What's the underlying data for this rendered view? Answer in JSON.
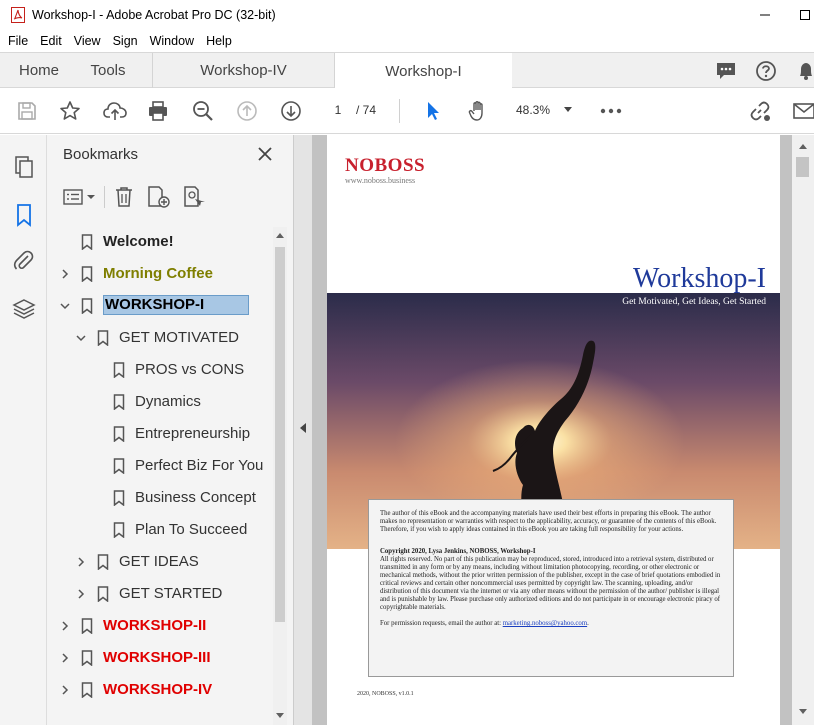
{
  "window": {
    "title": "Workshop-I - Adobe Acrobat Pro DC (32-bit)"
  },
  "menu": [
    "File",
    "Edit",
    "View",
    "Sign",
    "Window",
    "Help"
  ],
  "tabs": {
    "home": "Home",
    "tools": "Tools",
    "doc1": "Workshop-IV",
    "doc2": "Workshop-I"
  },
  "toolbar": {
    "page_current": "1",
    "page_total": "/ 74",
    "zoom": "48.3%"
  },
  "bookmarks": {
    "title": "Bookmarks",
    "items": [
      {
        "label": "Welcome!",
        "color": "#222222",
        "bold": true,
        "level": 0,
        "expander": "none"
      },
      {
        "label": "Morning Coffee",
        "color": "#7f7f00",
        "bold": true,
        "level": 0,
        "expander": "collapsed"
      },
      {
        "label": "WORKSHOP-I",
        "color": "#000000",
        "bold": true,
        "level": 0,
        "expander": "expanded",
        "selected": true
      },
      {
        "label": "GET MOTIVATED",
        "color": "#333333",
        "bold": false,
        "level": 1,
        "expander": "expanded"
      },
      {
        "label": "PROS vs CONS",
        "color": "#333333",
        "bold": false,
        "level": 2,
        "expander": "none"
      },
      {
        "label": "Dynamics",
        "color": "#333333",
        "bold": false,
        "level": 2,
        "expander": "none"
      },
      {
        "label": "Entrepreneurship",
        "color": "#333333",
        "bold": false,
        "level": 2,
        "expander": "none"
      },
      {
        "label": "Perfect Biz For You",
        "color": "#333333",
        "bold": false,
        "level": 2,
        "expander": "none"
      },
      {
        "label": "Business Concept",
        "color": "#333333",
        "bold": false,
        "level": 2,
        "expander": "none"
      },
      {
        "label": "Plan To Succeed",
        "color": "#333333",
        "bold": false,
        "level": 2,
        "expander": "none"
      },
      {
        "label": "GET IDEAS",
        "color": "#333333",
        "bold": false,
        "level": 1,
        "expander": "collapsed"
      },
      {
        "label": "GET STARTED",
        "color": "#333333",
        "bold": false,
        "level": 1,
        "expander": "collapsed"
      },
      {
        "label": "WORKSHOP-II",
        "color": "#e00000",
        "bold": true,
        "level": 0,
        "expander": "collapsed"
      },
      {
        "label": "WORKSHOP-III",
        "color": "#e00000",
        "bold": true,
        "level": 0,
        "expander": "collapsed"
      },
      {
        "label": "WORKSHOP-IV",
        "color": "#e00000",
        "bold": true,
        "level": 0,
        "expander": "collapsed"
      }
    ]
  },
  "document": {
    "logo": "NOBOSS",
    "logo_url": "www.noboss.business",
    "title": "Workshop-I",
    "subtitle": "Get Motivated, Get Ideas, Get Started",
    "disclaimer": "The author of this eBook and the accompanying materials have used their best efforts in preparing this eBook. The author makes no representation or warranties with respect to the applicability, accuracy, or guarantee of the contents of this eBook. Therefore, if you wish to apply ideas contained in this eBook you are taking full responsibility for your actions.",
    "copyright_head": "Copyright 2020, Lysa Jenkins, NOBOSS, Workshop-I",
    "copyright_body": "All rights reserved. No part of this publication may be reproduced, stored, introduced into a retrieval system, distributed or transmitted in any form or by any means, including without limitation photocopying, recording, or other electronic or mechanical methods, without the prior written permission of the publisher, except in the case of brief quotations embodied in critical reviews and certain other noncommercial uses permitted by copyright law. The scanning, uploading, and/or distribution of this document via the internet or via any other means without the permission of the author/ publisher is illegal and is punishable by law. Please purchase only authorized editions and do not participate in or encourage electronic piracy of copyrightable materials.",
    "permission_text": "For permission requests, email the author at: ",
    "email": "marketing.noboss@yahoo.com",
    "email_suffix": ".",
    "footer": "2020, NOBOSS, v1.0.1"
  },
  "icons": {
    "titlebar": [
      "pdf-app-icon",
      "minimize-icon",
      "maximize-icon"
    ],
    "toolbar": [
      "save-icon",
      "star-icon",
      "cloud-upload-icon",
      "print-icon",
      "zoom-out-icon",
      "page-up-icon",
      "page-down-icon",
      "select-cursor-icon",
      "hand-icon",
      "zoom-dropdown-icon",
      "more-icon",
      "share-link-icon",
      "email-icon"
    ],
    "tabbar": [
      "comment-icon",
      "help-icon",
      "bell-icon"
    ],
    "leftnav": [
      "pages-icon",
      "bookmark-icon",
      "attachment-icon",
      "layers-icon"
    ],
    "bookmark_tools": [
      "options-icon",
      "delete-icon",
      "new-bookmark-icon",
      "search-bookmark-icon",
      "close-icon"
    ]
  },
  "colors": {
    "accent": "#1473e6",
    "selection": "#a8c7e4",
    "title_blue": "#1f3a9a",
    "logo_red": "#c8202d"
  }
}
